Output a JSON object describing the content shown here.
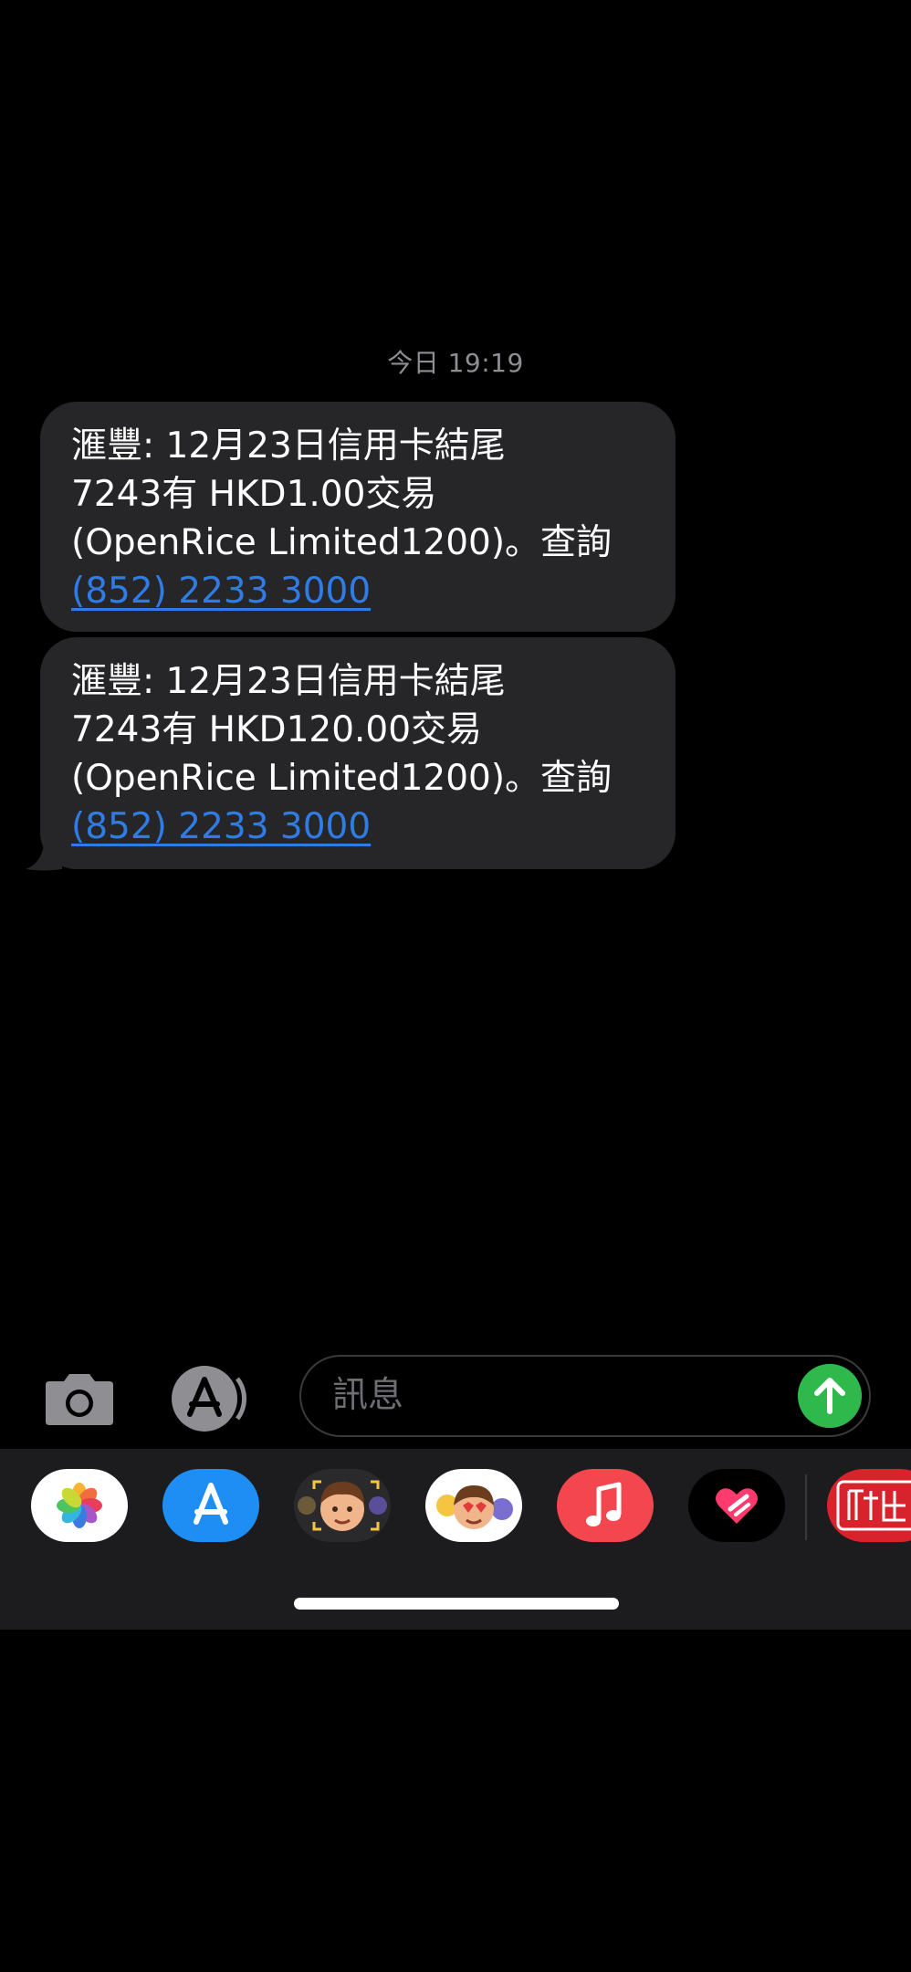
{
  "timestamp": "今日 19:19",
  "messages": [
    {
      "lines": [
        "滙豐: 12月23日信用卡結尾",
        "7243有 HKD1.00交易",
        "(OpenRice Limited1200)。查詢"
      ],
      "phone": "(852) 2233 3000"
    },
    {
      "lines": [
        "滙豐: 12月23日信用卡結尾",
        "7243有 HKD120.00交易",
        "(OpenRice Limited1200)。查詢"
      ],
      "phone": "(852) 2233 3000"
    }
  ],
  "input": {
    "placeholder": "訊息"
  },
  "app_drawer": {
    "apps": [
      "photos-icon",
      "app-store-icon",
      "memoji-icon",
      "animoji-stickers-icon",
      "music-icon",
      "digital-touch-icon",
      "red-stamp-app-icon"
    ]
  },
  "colors": {
    "bubble": "#262629",
    "link": "#2f7ce6",
    "send": "#2fb84c",
    "music": "#f3464f"
  }
}
